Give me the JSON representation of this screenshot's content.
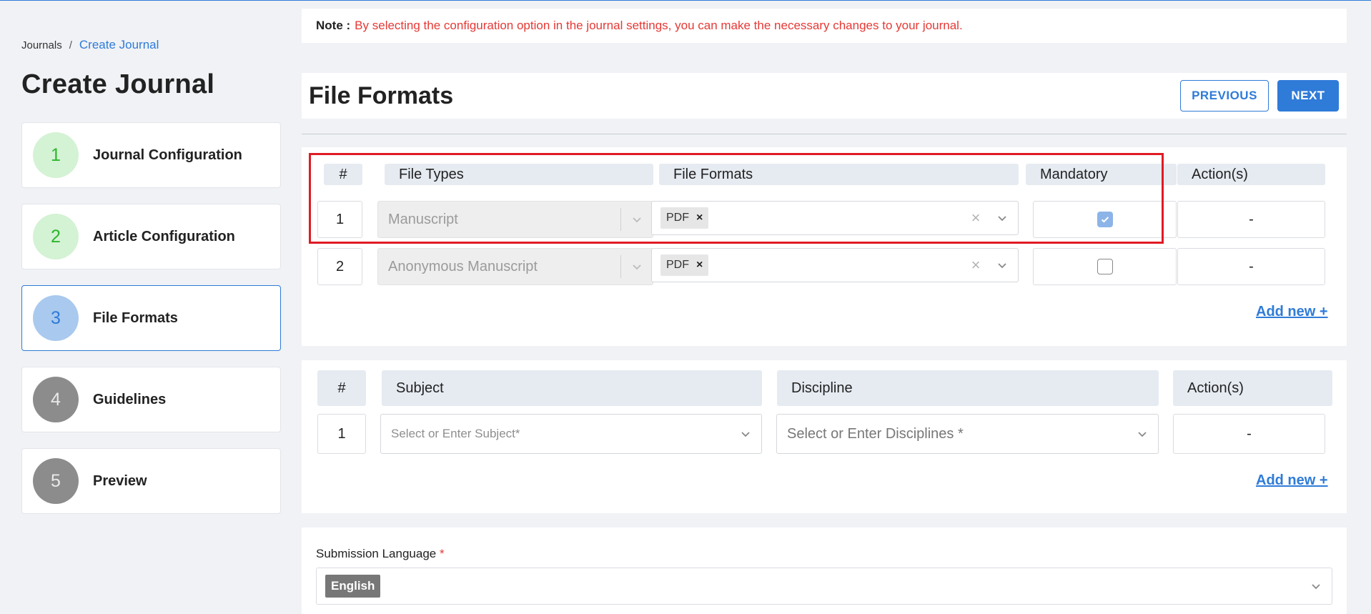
{
  "breadcrumb": {
    "root": "Journals",
    "separator": "/",
    "current": "Create Journal"
  },
  "page_title": "Create Journal",
  "steps": [
    {
      "number": "1",
      "label": "Journal Configuration",
      "state": "done"
    },
    {
      "number": "2",
      "label": "Article Configuration",
      "state": "done"
    },
    {
      "number": "3",
      "label": "File Formats",
      "state": "current"
    },
    {
      "number": "4",
      "label": "Guidelines",
      "state": "todo"
    },
    {
      "number": "5",
      "label": "Preview",
      "state": "todo"
    }
  ],
  "note": {
    "label": "Note :",
    "text": "By selecting the configuration option in the journal settings, you can make the necessary changes to your journal."
  },
  "section_title": "File Formats",
  "buttons": {
    "previous": "PREVIOUS",
    "next": "NEXT"
  },
  "formats_table": {
    "headers": {
      "num": "#",
      "file_types": "File Types",
      "file_formats": "File Formats",
      "mandatory": "Mandatory",
      "actions": "Action(s)"
    },
    "rows": [
      {
        "num": "1",
        "file_type": "Manuscript",
        "format_tag": "PDF",
        "mandatory": true,
        "action": "-"
      },
      {
        "num": "2",
        "file_type": "Anonymous Manuscript",
        "format_tag": "PDF",
        "mandatory": false,
        "action": "-"
      }
    ],
    "add_new": "Add new +"
  },
  "subjects_table": {
    "headers": {
      "num": "#",
      "subject": "Subject",
      "discipline": "Discipline",
      "actions": "Action(s)"
    },
    "rows": [
      {
        "num": "1",
        "subject_placeholder": "Select or Enter Subject*",
        "discipline_placeholder": "Select or Enter Disciplines *",
        "action": "-"
      }
    ],
    "add_new": "Add new +"
  },
  "submission_language": {
    "label": "Submission Language",
    "required_mark": "*",
    "value": "English"
  },
  "colors": {
    "accent": "#2f7bd8",
    "note_red": "#e53935",
    "highlight": "#e01b24",
    "step_done": "#2db52d"
  },
  "icons": {
    "chevron": "chevron-down-icon",
    "clear": "clear-icon",
    "check": "check-icon"
  }
}
